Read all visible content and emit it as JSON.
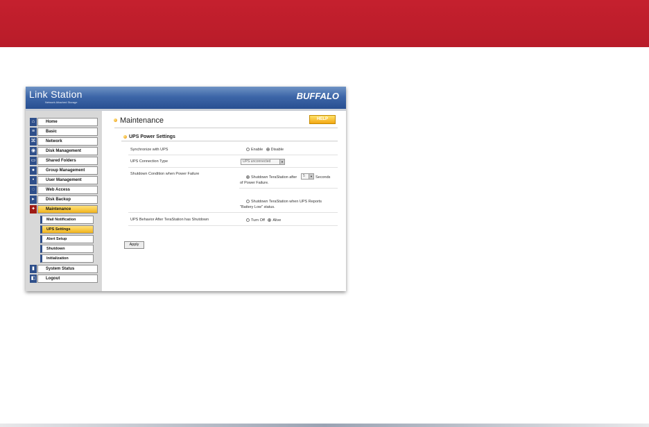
{
  "header": {
    "logo": "Link Station",
    "logo_sub": "Network Attached Storage",
    "brand": "BUFFALO"
  },
  "sidebar": {
    "items": [
      {
        "label": "Home",
        "icon": "home-icon"
      },
      {
        "label": "Basic",
        "icon": "document-icon"
      },
      {
        "label": "Network",
        "icon": "network-icon"
      },
      {
        "label": "Disk Management",
        "icon": "disk-icon"
      },
      {
        "label": "Shared Folders",
        "icon": "folder-icon"
      },
      {
        "label": "Group Management",
        "icon": "group-icon"
      },
      {
        "label": "User Management",
        "icon": "user-icon"
      },
      {
        "label": "Web Access",
        "icon": "web-icon"
      },
      {
        "label": "Disk Backup",
        "icon": "backup-icon"
      },
      {
        "label": "Maintenance",
        "icon": "tools-icon"
      }
    ],
    "subitems": [
      {
        "label": "Mail Notification"
      },
      {
        "label": "UPS Settings"
      },
      {
        "label": "Alert Setup"
      },
      {
        "label": "Shutdown"
      },
      {
        "label": "Initialization"
      }
    ],
    "bottom_items": [
      {
        "label": "System Status",
        "icon": "status-icon"
      },
      {
        "label": "Logout",
        "icon": "logout-icon"
      }
    ]
  },
  "main": {
    "title": "Maintenance",
    "help_label": "HELP",
    "section_title": "UPS Power Settings",
    "rows": {
      "sync": {
        "label": "Synchronize with UPS",
        "opt_enable": "Enable",
        "opt_disable": "Disable",
        "selected": "Disable"
      },
      "conn": {
        "label": "UPS Connection Type",
        "value": "UPS unconnected"
      },
      "shutdown": {
        "label": "Shutdown Condition when Power Failure",
        "opt1_pre": "Shutdown TeraStation after",
        "opt1_value": "5",
        "opt1_post": "Seconds",
        "opt1_post2": "of Power Failure.",
        "opt2_line1": "Shutdown TeraStation when UPS Reports",
        "opt2_line2": "\"Battery Low\" status."
      },
      "behavior": {
        "label": "UPS Behavior After TeraStation has Shutdown",
        "opt_off": "Turn Off",
        "opt_alive": "Alive",
        "selected": "Alive"
      }
    },
    "apply_label": "Apply"
  },
  "colors": {
    "banner": "#c0202d",
    "header_blue": "#3d66a8",
    "active_yellow": "#f1b31c"
  }
}
